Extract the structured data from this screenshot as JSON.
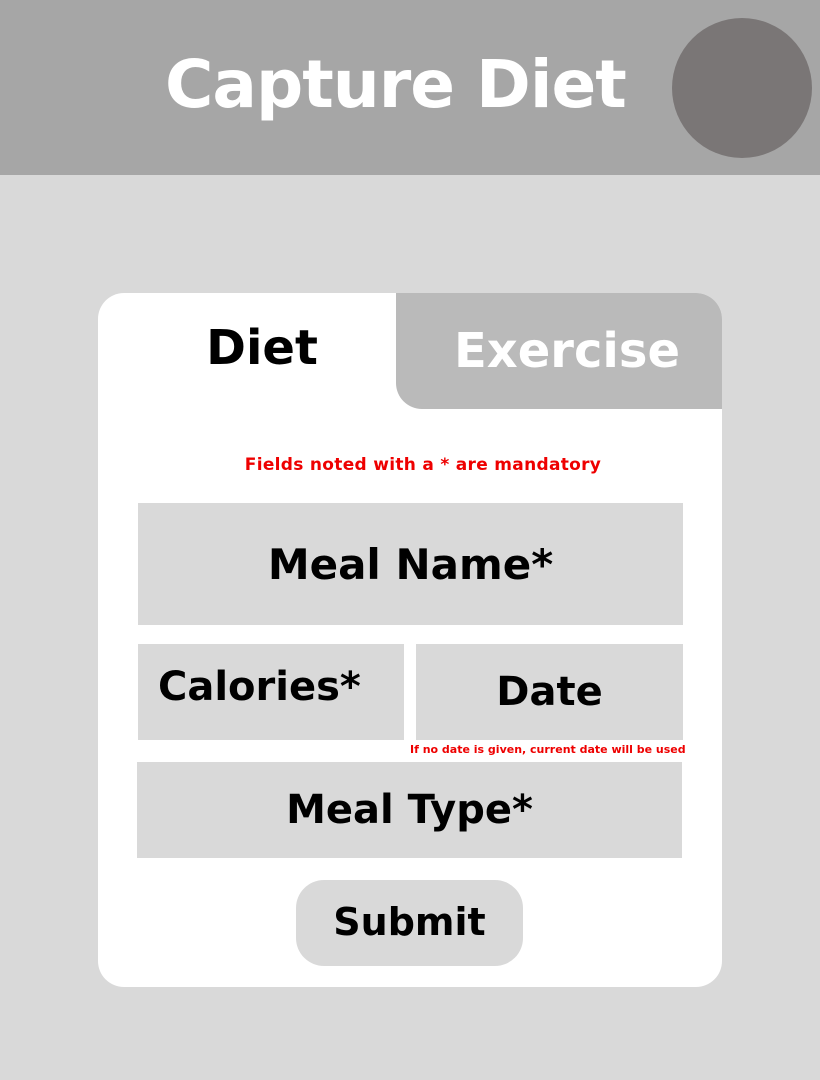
{
  "header": {
    "title": "Capture Diet",
    "background": "#a6a6a6",
    "avatar_color": "#7a7676"
  },
  "tabs": [
    {
      "label": "Diet",
      "active": true
    },
    {
      "label": "Exercise",
      "active": false
    }
  ],
  "form": {
    "mandatory_note": "Fields noted with a * are mandatory",
    "meal_name_placeholder": "Meal Name*",
    "calories_placeholder": "Calories*",
    "date_placeholder": "Date",
    "date_hint": "If  no date is given, current date will be used",
    "meal_type_placeholder": "Meal Type*",
    "submit_label": "Submit"
  },
  "colors": {
    "page_background": "#d9d9d9",
    "card_background": "#ffffff",
    "inactive_tab": "#bababa",
    "warning_text": "#ee0000"
  }
}
